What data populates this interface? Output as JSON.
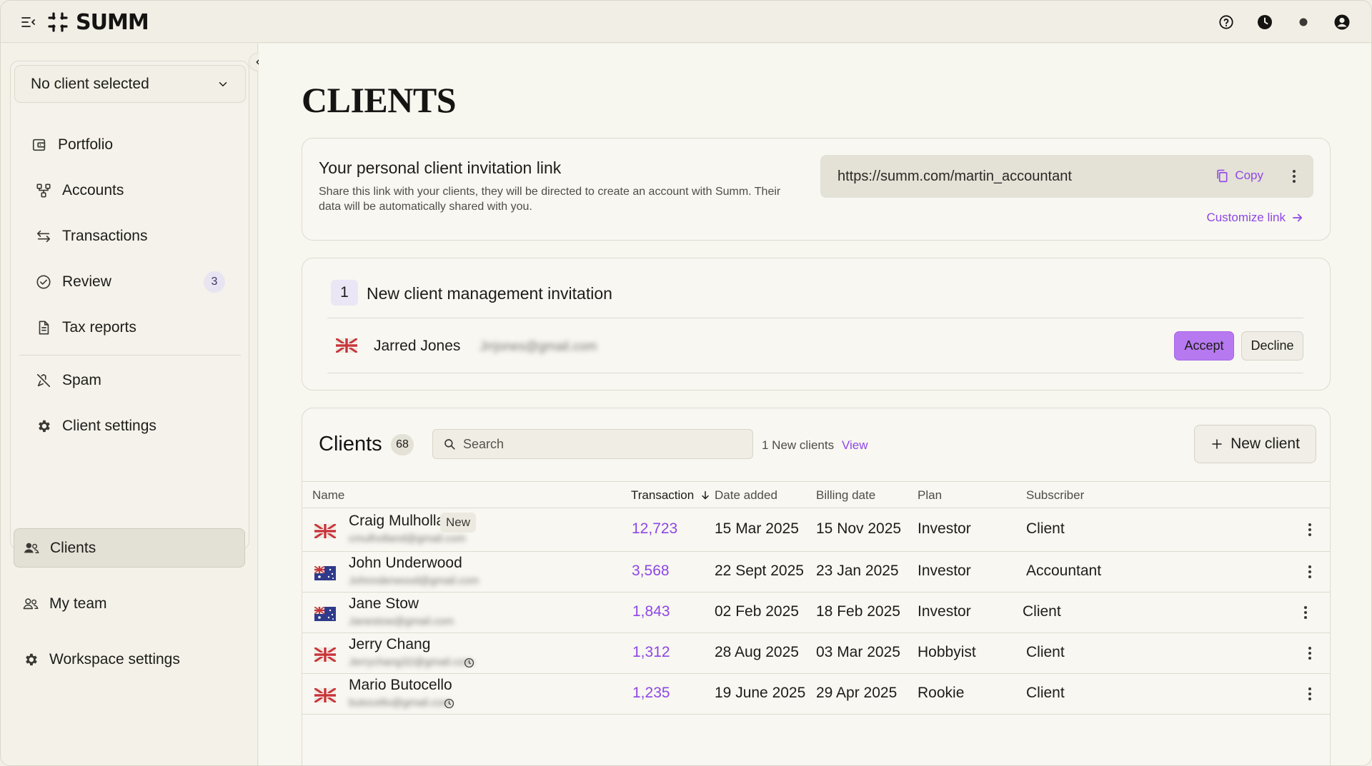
{
  "app": {
    "logo_text": "SUMM"
  },
  "sidebar": {
    "client_select": "No client selected",
    "items": [
      {
        "label": "Portfolio",
        "icon": "wallet-icon"
      },
      {
        "label": "Accounts",
        "icon": "accounts-tree-icon"
      },
      {
        "label": "Transactions",
        "icon": "swap-arrows-icon"
      },
      {
        "label": "Review",
        "icon": "check-circle-icon",
        "badge": "3"
      },
      {
        "label": "Tax reports",
        "icon": "document-icon"
      },
      {
        "label": "Spam",
        "icon": "spam-icon"
      },
      {
        "label": "Client settings",
        "icon": "gear-icon"
      }
    ],
    "outer_items": [
      {
        "label": "Clients",
        "icon": "users-icon",
        "active": true
      },
      {
        "label": "My team",
        "icon": "team-icon"
      },
      {
        "label": "Workspace settings",
        "icon": "gear-icon"
      }
    ]
  },
  "main": {
    "title": "CLIENTS",
    "invite": {
      "title": "Your personal client invitation link",
      "description": "Share this link with your clients, they will be directed to create an account with Summ. Their data will be automatically shared with you.",
      "link": "https://summ.com/martin_accountant",
      "copy_label": "Copy",
      "customize_label": "Customize link"
    },
    "new_invitations": {
      "count": "1",
      "title": "New client management invitation",
      "row": {
        "name": "Jarred Jones",
        "email": "Jrrjones@gmail.com",
        "flag": "uk",
        "accept_label": "Accept",
        "decline_label": "Decline"
      }
    },
    "clients": {
      "title": "Clients",
      "count": "68",
      "search_placeholder": "Search",
      "new_clients_text": "1 New clients",
      "view_label": "View",
      "new_client_label": "New client",
      "columns": {
        "name": "Name",
        "transaction": "Transaction",
        "date_added": "Date added",
        "billing_date": "Billing date",
        "plan": "Plan",
        "subscriber": "Subscriber"
      },
      "rows": [
        {
          "name": "Craig Mulholland",
          "email": "cmulholland@gmail.com",
          "flag": "uk",
          "tag": "New",
          "transactions": "12,723",
          "date_added": "15 Mar 2025",
          "billing_date": "15 Nov 2025",
          "plan": "Investor",
          "subscriber": "Client"
        },
        {
          "name": "John Underwood",
          "email": "Johnnderwood@gmail.com",
          "flag": "au",
          "transactions": "3,568",
          "date_added": "22 Sept 2025",
          "billing_date": "23 Jan 2025",
          "plan": "Investor",
          "subscriber": "Accountant"
        },
        {
          "name": "Jane Stow",
          "email": "Janestow@gmail.com",
          "flag": "au",
          "transactions": "1,843",
          "date_added": "02 Feb 2025",
          "billing_date": "18 Feb 2025",
          "plan": "Investor",
          "subscriber": "Client"
        },
        {
          "name": "Jerry Chang",
          "email": "Jerrychang32@gmail.com",
          "flag": "uk",
          "clock": true,
          "transactions": "1,312",
          "date_added": "28 Aug 2025",
          "billing_date": "03 Mar 2025",
          "plan": "Hobbyist",
          "subscriber": "Client"
        },
        {
          "name": "Mario Butocello",
          "email": "butocello@gmail.com",
          "flag": "uk",
          "clock": true,
          "transactions": "1,235",
          "date_added": "19 June 2025",
          "billing_date": "29 Apr 2025",
          "plan": "Rookie",
          "subscriber": "Client"
        }
      ]
    }
  },
  "colors": {
    "accent": "#8d47e6",
    "accept_bg": "#b679f0",
    "background": "#f7f6ef"
  }
}
